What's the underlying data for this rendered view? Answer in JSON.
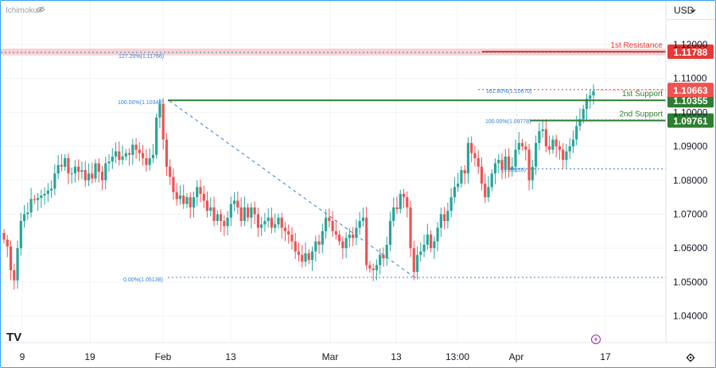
{
  "indicator": {
    "label": "Ichimoku"
  },
  "currency": {
    "label": "USD"
  },
  "logo": "TV",
  "colors": {
    "up": "#26a69a",
    "down": "#ef5350",
    "support": "#2e7d32",
    "resistance": "#e53935",
    "fib": "#2f7fd6",
    "grid": "#f2f3f5"
  },
  "chart_data": {
    "type": "candlestick",
    "ylim": [
      1.034,
      1.1235
    ],
    "y_ticks": [
      {
        "value": 1.12,
        "label": "1.12000"
      },
      {
        "value": 1.11,
        "label": "1.11000"
      },
      {
        "value": 1.1,
        "label": "1.10000"
      },
      {
        "value": 1.09,
        "label": "1.09000"
      },
      {
        "value": 1.08,
        "label": "1.08000"
      },
      {
        "value": 1.07,
        "label": "1.07000"
      },
      {
        "value": 1.06,
        "label": "1.06000"
      },
      {
        "value": 1.05,
        "label": "1.05000"
      },
      {
        "value": 1.04,
        "label": "1.04000"
      }
    ],
    "x_ticks": [
      "9",
      "19",
      "Feb",
      "13",
      "Mar",
      "13",
      "13:00",
      "Apr",
      "17"
    ],
    "close": [
      1.0625,
      1.0605,
      1.0535,
      1.0505,
      1.06,
      1.068,
      1.07,
      1.0705,
      1.0745,
      1.0742,
      1.0748,
      1.0755,
      1.076,
      1.077,
      1.0775,
      1.082,
      1.0845,
      1.084,
      1.0865,
      1.082,
      1.082,
      1.084,
      1.0825,
      1.083,
      1.08,
      1.082,
      1.0805,
      1.085,
      1.0825,
      1.08,
      1.085,
      1.0855,
      1.087,
      1.0885,
      1.086,
      1.087,
      1.088,
      1.0875,
      1.0905,
      1.089,
      1.088,
      1.0865,
      1.0845,
      1.0865,
      1.0875,
      1.0985,
      1.1025,
      1.092,
      1.084,
      1.081,
      1.0765,
      1.0745,
      1.0755,
      1.073,
      1.075,
      1.072,
      1.075,
      1.078,
      1.076,
      1.074,
      1.071,
      1.072,
      1.068,
      1.07,
      1.068,
      1.0665,
      1.069,
      1.073,
      1.074,
      1.072,
      1.068,
      1.072,
      1.069,
      1.072,
      1.07,
      1.066,
      1.067,
      1.068,
      1.069,
      1.066,
      1.067,
      1.069,
      1.066,
      1.065,
      1.064,
      1.062,
      1.059,
      1.058,
      1.056,
      1.0585,
      1.0565,
      1.059,
      1.062,
      1.061,
      1.065,
      1.069,
      1.068,
      1.065,
      1.064,
      1.062,
      1.06,
      1.063,
      1.064,
      1.063,
      1.066,
      1.068,
      1.069,
      1.055,
      1.054,
      1.0535,
      1.055,
      1.058,
      1.057,
      1.061,
      1.068,
      1.072,
      1.0715,
      1.076,
      1.075,
      1.072,
      1.06,
      1.053,
      1.058,
      1.059,
      1.061,
      1.064,
      1.06,
      1.062,
      1.066,
      1.07,
      1.068,
      1.071,
      1.075,
      1.078,
      1.079,
      1.083,
      1.082,
      1.091,
      1.088,
      1.0865,
      1.084,
      1.079,
      1.075,
      1.078,
      1.082,
      1.085,
      1.086,
      1.083,
      1.087,
      1.083,
      1.084,
      1.089,
      1.091,
      1.09,
      1.089,
      1.08,
      1.084,
      1.091,
      1.0945,
      1.095,
      1.09,
      1.089,
      1.092,
      1.09,
      1.089,
      1.086,
      1.0885,
      1.09,
      1.092,
      1.096,
      1.098,
      1.101,
      1.104,
      1.105,
      1.1063
    ],
    "levels": [
      {
        "name": "1st Resistance",
        "value": 1.11788,
        "label": "1.11788",
        "kind": "resistance"
      },
      {
        "name": "1st Support",
        "value": 1.10355,
        "label": "1.10355",
        "kind": "support"
      },
      {
        "name": "2nd Support",
        "value": 1.09761,
        "label": "1.09761",
        "kind": "support"
      }
    ],
    "current_price": {
      "value": 1.10663,
      "label": "1.10663"
    },
    "fib_labels": [
      {
        "text": "127.20%(1.11766)",
        "value": 1.11766
      },
      {
        "text": "100.00%(1.10348)",
        "value": 1.10348
      },
      {
        "text": "161.80%(1.10670)",
        "value": 1.1067
      },
      {
        "text": "100.00%(1.09778)",
        "value": 1.09778
      },
      {
        "text": "0.00%(1.05138)",
        "value": 1.05138
      },
      {
        "text": "(1.08335)",
        "value": 1.08335
      }
    ],
    "fib_lines": [
      1.11766,
      1.1067,
      1.09778,
      1.08335,
      1.05138
    ]
  }
}
